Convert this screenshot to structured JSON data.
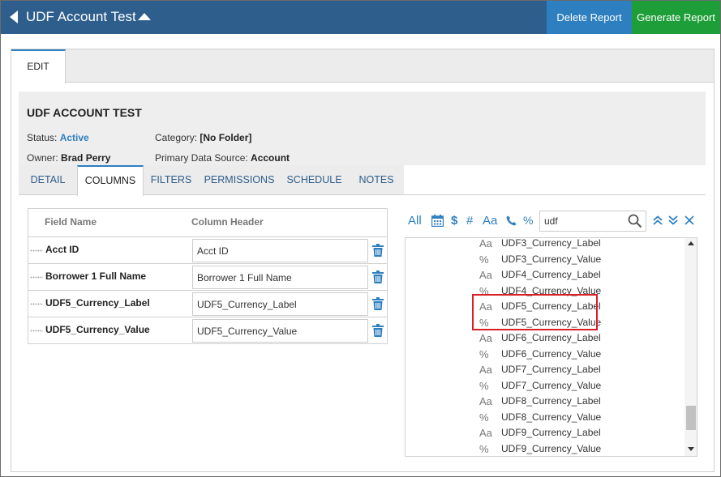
{
  "topbar": {
    "title": "UDF Account Test",
    "delete_label": "Delete Report",
    "generate_label": "Generate Report",
    "bar_color": "#2e5e8c"
  },
  "edit_tab": {
    "label": "EDIT"
  },
  "report": {
    "title": "UDF ACCOUNT TEST",
    "status_label": "Status:",
    "status_value": "Active",
    "category_label": "Category:",
    "category_value": "[No Folder]",
    "owner_label": "Owner:",
    "owner_value": "Brad Perry",
    "source_label": "Primary Data Source:",
    "source_value": "Account"
  },
  "subtabs": [
    "DETAIL",
    "COLUMNS",
    "FILTERS",
    "PERMISSIONS",
    "SCHEDULE",
    "NOTES"
  ],
  "subtab_active": "COLUMNS",
  "columns": {
    "header_field": "Field Name",
    "header_column": "Column Header",
    "rows": [
      {
        "field": "Acct ID",
        "header": "Acct ID"
      },
      {
        "field": "Borrower 1 Full Name",
        "header": "Borrower 1 Full Name"
      },
      {
        "field": "UDF5_Currency_Label",
        "header": "UDF5_Currency_Label"
      },
      {
        "field": "UDF5_Currency_Value",
        "header": "UDF5_Currency_Value"
      }
    ]
  },
  "picker": {
    "filters": {
      "all": "All",
      "currency": "$",
      "number": "#",
      "text": "Aa",
      "percent": "%"
    },
    "search_value": "udf",
    "items": [
      {
        "type": "Aa",
        "name": "UDF3_Currency_Label"
      },
      {
        "type": "%",
        "name": "UDF3_Currency_Value"
      },
      {
        "type": "Aa",
        "name": "UDF4_Currency_Label"
      },
      {
        "type": "%",
        "name": "UDF4_Currency_Value"
      },
      {
        "type": "Aa",
        "name": "UDF5_Currency_Label"
      },
      {
        "type": "%",
        "name": "UDF5_Currency_Value"
      },
      {
        "type": "Aa",
        "name": "UDF6_Currency_Label"
      },
      {
        "type": "%",
        "name": "UDF6_Currency_Value"
      },
      {
        "type": "Aa",
        "name": "UDF7_Currency_Label"
      },
      {
        "type": "%",
        "name": "UDF7_Currency_Value"
      },
      {
        "type": "Aa",
        "name": "UDF8_Currency_Label"
      },
      {
        "type": "%",
        "name": "UDF8_Currency_Value"
      },
      {
        "type": "Aa",
        "name": "UDF9_Currency_Label"
      },
      {
        "type": "%",
        "name": "UDF9_Currency_Value"
      }
    ],
    "highlight_color": "#d81f26"
  }
}
